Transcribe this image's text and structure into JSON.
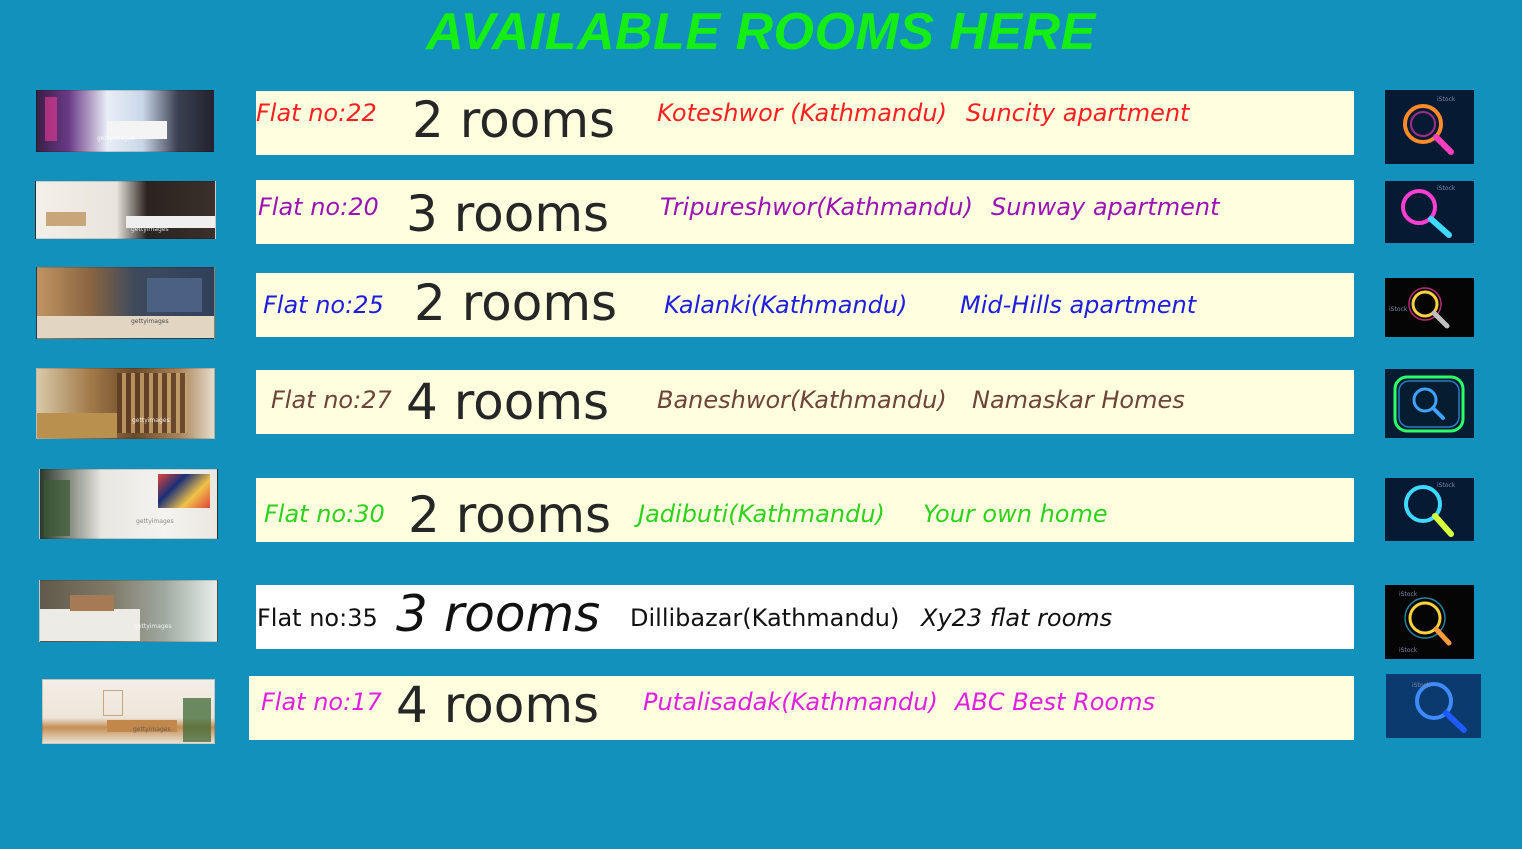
{
  "title": "AVAILABLE ROOMS HERE",
  "listings": [
    {
      "flat": "Flat no:22",
      "rooms": "2 rooms",
      "location": "Koteshwor (Kathmandu)",
      "name": "Suncity apartment",
      "color": "#ff1f1f",
      "search_color": "#ff8a2a",
      "search_color2": "#ff3fbf"
    },
    {
      "flat": "Flat no:20",
      "rooms": "3 rooms",
      "location": "Tripureshwor(Kathmandu)",
      "name": "Sunway apartment",
      "color": "#9b13b5",
      "search_color": "#ff3fd2",
      "search_color2": "#3fd8ff"
    },
    {
      "flat": "Flat no:25",
      "rooms": "2 rooms",
      "location": "Kalanki(Kathmandu)",
      "name": "Mid-Hills apartment",
      "color": "#1d1dde",
      "search_color": "#ffd23f",
      "search_color2": "#c0c0c0"
    },
    {
      "flat": "Flat no:27",
      "rooms": "4 rooms",
      "location": "Baneshwor(Kathmandu)",
      "name": "Namaskar Homes",
      "color": "#6e4338",
      "search_color": "#3fa2ff",
      "search_color2": "#2bff6a"
    },
    {
      "flat": "Flat no:30",
      "rooms": "2 rooms",
      "location": "Jadibuti(Kathmandu)",
      "name": "Your own home",
      "color": "#2ed21d",
      "search_color": "#3fd8ff",
      "search_color2": "#d8ff3f"
    },
    {
      "flat": "Flat no:35",
      "rooms": "3 rooms",
      "location": "Dillibazar(Kathmandu)",
      "name": "Xy23  flat rooms",
      "color": "#111111",
      "search_color": "#ffd23f",
      "search_color2": "#3fd8ff"
    },
    {
      "flat": "Flat no:17",
      "rooms": "4 rooms",
      "location": "Putalisadak(Kathmandu)",
      "name": "ABC Best Rooms",
      "color": "#e020e0",
      "search_color": "#3f8aff",
      "search_color2": "#1e5aff"
    }
  ],
  "photo_watermark": "gettyimages",
  "icon_watermark": "iStock",
  "icons": {
    "room_photo": "room-photo",
    "search": "search-icon"
  }
}
